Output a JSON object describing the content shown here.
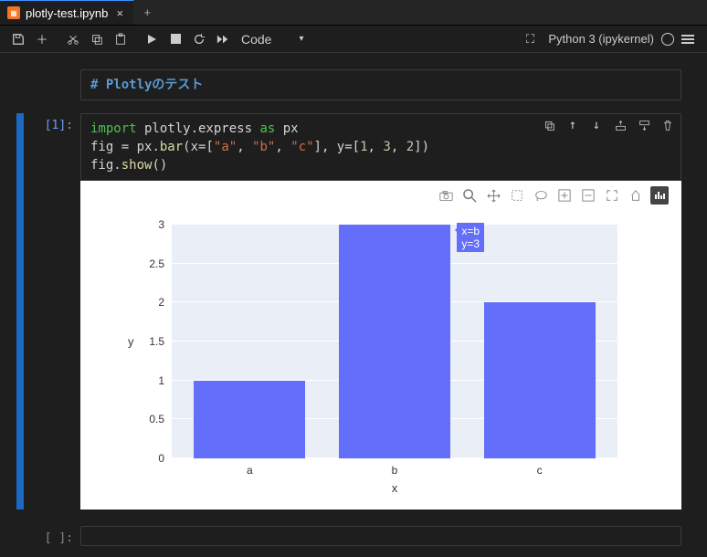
{
  "tab": {
    "title": "plotly-test.ipynb"
  },
  "toolbar": {
    "celltype": "Code"
  },
  "kernel": {
    "name": "Python 3 (ipykernel)"
  },
  "markdown_cell": {
    "source": "# Plotlyのテスト"
  },
  "code_cell": {
    "prompt": "[1]:",
    "lines": {
      "l1a": "import",
      "l1b": " plotly.express ",
      "l1c": "as",
      "l1d": " px",
      "l2a": "fig ",
      "l2b": "=",
      "l2c": " px.",
      "l2d": "bar",
      "l2e": "(x",
      "l2f": "=",
      "l2g": "[",
      "l2h": "\"a\"",
      "l2i": ", ",
      "l2j": "\"b\"",
      "l2k": ", ",
      "l2l": "\"c\"",
      "l2m": "], y",
      "l2n": "=",
      "l2o": "[",
      "l2p": "1",
      "l2q": ", ",
      "l2r": "3",
      "l2s": ", ",
      "l2t": "2",
      "l2u": "])",
      "l3a": "fig.",
      "l3b": "show",
      "l3c": "()"
    }
  },
  "empty_cell": {
    "prompt": "[ ]:"
  },
  "chart_data": {
    "type": "bar",
    "categories": [
      "a",
      "b",
      "c"
    ],
    "values": [
      1,
      3,
      2
    ],
    "xlabel": "x",
    "ylabel": "y",
    "ylim": [
      0,
      3
    ],
    "yticks": [
      0,
      0.5,
      1,
      1.5,
      2,
      2.5,
      3
    ],
    "hover": {
      "text1": "x=b",
      "text2": "y=3"
    }
  }
}
